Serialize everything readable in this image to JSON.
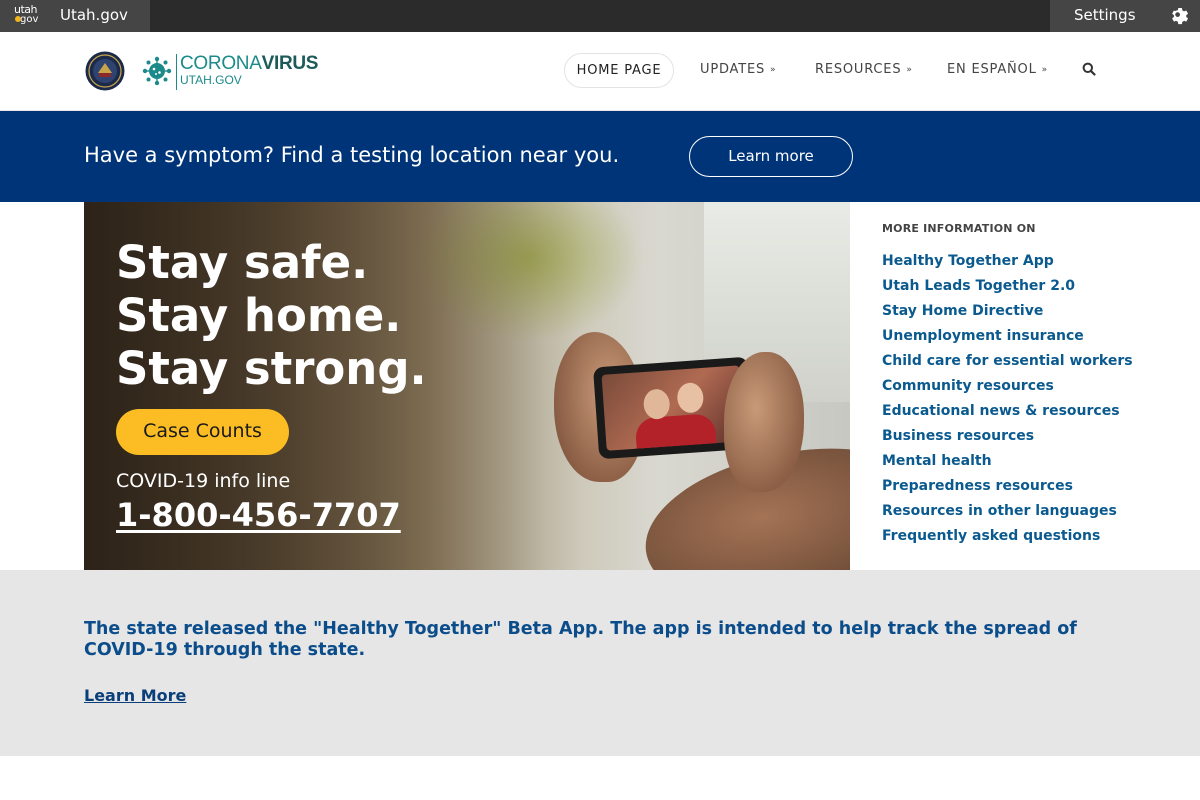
{
  "topbar": {
    "logo_line1": "utah",
    "logo_line2": "gov",
    "site_name": "Utah.gov",
    "settings_label": "Settings",
    "icons": {
      "settings": "gear-icon",
      "logo": "utah-gov-logo"
    }
  },
  "header": {
    "logo": {
      "word_light": "CORONA",
      "word_bold": "VIRUS",
      "subline": "UTAH.GOV",
      "accent_color": "#1c8a8a"
    },
    "nav": {
      "home": "HOME PAGE",
      "updates": "UPDATES",
      "resources": "RESOURCES",
      "espanol": "EN ESPAÑOL",
      "chevron": "»",
      "search_icon": "search-icon"
    }
  },
  "banner": {
    "text": "Have a symptom? Find a testing location near you.",
    "button": "Learn more",
    "background": "#003478"
  },
  "hero": {
    "line1": "Stay safe.",
    "line2": "Stay home.",
    "line3": "Stay strong.",
    "button": "Case Counts",
    "button_color": "#fbbd23",
    "info_label": "COVID-19 info line",
    "phone": "1-800-456-7707"
  },
  "sidebar": {
    "heading": "MORE INFORMATION ON",
    "links": [
      "Healthy Together App",
      "Utah Leads Together 2.0",
      "Stay Home Directive",
      "Unemployment insurance",
      "Child care for essential workers",
      "Community resources",
      "Educational news & resources",
      "Business resources",
      "Mental health",
      "Preparedness resources",
      "Resources in other languages",
      "Frequently asked questions"
    ],
    "link_color": "#0b5a8f"
  },
  "notice": {
    "text": "The state released the \"Healthy Together\" Beta App. The app is intended to help track the spread of COVID-19 through the state.",
    "link": "Learn More"
  }
}
